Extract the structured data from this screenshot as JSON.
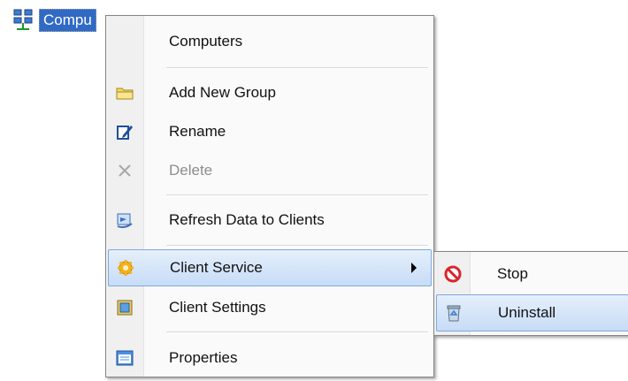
{
  "tree": {
    "node_label": "Compu"
  },
  "menu": {
    "items": [
      {
        "label": "Computers",
        "icon": "none",
        "disabled": false
      },
      {
        "label": "Add New Group",
        "icon": "folder-icon",
        "disabled": false
      },
      {
        "label": "Rename",
        "icon": "rename-pencil-icon",
        "disabled": false
      },
      {
        "label": "Delete",
        "icon": "delete-x-icon",
        "disabled": true
      },
      {
        "label": "Refresh Data to Clients",
        "icon": "refresh-data-icon",
        "disabled": false
      },
      {
        "label": "Client Service",
        "icon": "gear-icon",
        "disabled": false,
        "has_submenu": true,
        "highlighted": true
      },
      {
        "label": "Client Settings",
        "icon": "client-settings-icon",
        "disabled": false
      },
      {
        "label": "Properties",
        "icon": "properties-icon",
        "disabled": false
      }
    ]
  },
  "submenu": {
    "items": [
      {
        "label": "Stop",
        "icon": "stop-icon"
      },
      {
        "label": "Uninstall",
        "icon": "recycle-bin-icon",
        "highlighted": true
      }
    ]
  },
  "colors": {
    "selection_blue": "#316ac5",
    "highlight_border": "#7fa9dc",
    "stop_red": "#d8262e"
  }
}
